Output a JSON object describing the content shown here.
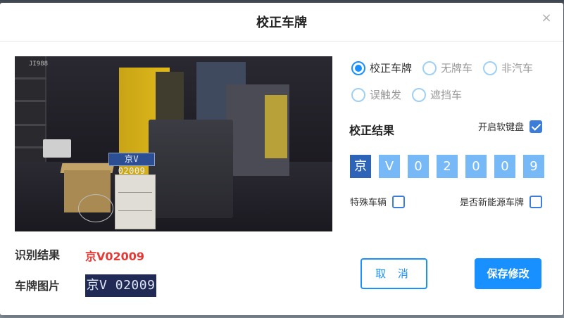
{
  "dialog": {
    "title": "校正车牌",
    "close_glyph": "×"
  },
  "camera": {
    "plate_text": "京V 02009",
    "corner_text": "JI988"
  },
  "options": [
    {
      "label": "校正车牌",
      "checked": true
    },
    {
      "label": "无牌车",
      "checked": false
    },
    {
      "label": "非汽车",
      "checked": false
    },
    {
      "label": "误触发",
      "checked": false
    },
    {
      "label": "遮挡车",
      "checked": false
    }
  ],
  "correction": {
    "title": "校正结果",
    "keyboard_label": "开启软键盘",
    "keyboard_checked": true,
    "chars": [
      "京",
      "V",
      "0",
      "2",
      "0",
      "0",
      "9"
    ],
    "special_label": "特殊车辆",
    "special_checked": false,
    "new_energy_label": "是否新能源车牌",
    "new_energy_checked": false
  },
  "result": {
    "label": "识别结果",
    "value": "京V02009",
    "value_color": "#e53935"
  },
  "plate_image": {
    "label": "车牌图片",
    "text": "京V 02009"
  },
  "buttons": {
    "cancel": "取 消",
    "save": "保存修改"
  },
  "colors": {
    "accent": "#1890ff",
    "char_box": "#77b9f7",
    "char_box_first": "#2e64b8"
  }
}
